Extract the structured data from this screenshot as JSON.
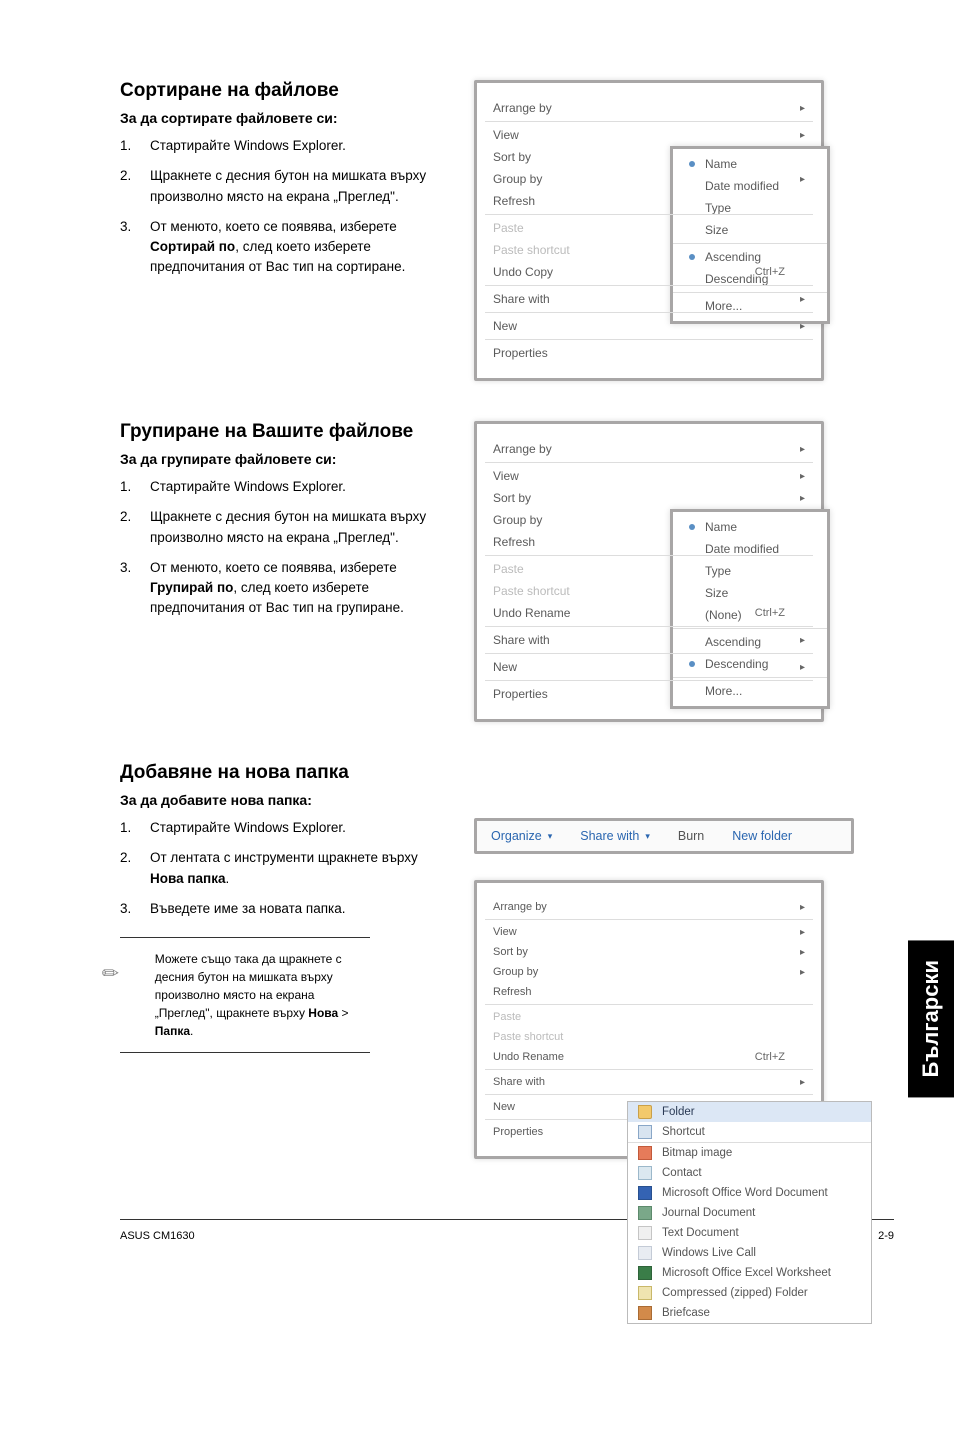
{
  "side_tab": "Български",
  "section1": {
    "heading": "Сортиране на файлове",
    "subheading": "За да сортирате файловете си:",
    "steps": [
      "Стартирайте Windows Explorer.",
      "Щракнете с десния бутон на мишката върху произволно място на екрана „Преглед\".",
      "От менюто, което се появява, изберете Сортирай по, след което изберете предпочитания от Вас тип на сортиране."
    ],
    "bold_in_step3": "Сортирай по"
  },
  "section2": {
    "heading": "Групиране на Вашите файлове",
    "subheading": "За да групирате файловете си:",
    "steps": [
      "Стартирайте Windows Explorer.",
      "Щракнете с десния бутон на мишката върху произволно място на екрана „Преглед\".",
      "От менюто, което се появява, изберете Групирай по, след което изберете предпочитания от Вас тип на групиране."
    ],
    "bold_in_step3": "Групирай по"
  },
  "section3": {
    "heading": "Добавяне на нова папка",
    "subheading": "За да добавите нова папка:",
    "steps": [
      "Стартирайте Windows Explorer.",
      "От лентата с инструменти щракнете върху Нова папка.",
      "Въведете име за новата папка."
    ],
    "bold_in_step2": "Нова папка",
    "tip": "Можете също така да щракнете с десния бутон на мишката върху произволно място на екрана „Преглед\", щракнете върху Нова > Папка.",
    "tip_bold1": "Нова",
    "tip_bold2": "Папка"
  },
  "menu1": {
    "items": [
      "Arrange by",
      "View",
      "Sort by",
      "Group by",
      "Refresh",
      "Paste",
      "Paste shortcut",
      "Undo Copy",
      "Share with",
      "New",
      "Properties"
    ],
    "shortcut": "Ctrl+Z",
    "submenu": [
      "Name",
      "Date modified",
      "Type",
      "Size",
      "Ascending",
      "Descending",
      "More..."
    ]
  },
  "menu2": {
    "items": [
      "Arrange by",
      "View",
      "Sort by",
      "Group by",
      "Refresh",
      "Paste",
      "Paste shortcut",
      "Undo Rename",
      "Share with",
      "New",
      "Properties"
    ],
    "shortcut": "Ctrl+Z",
    "submenu": [
      "Name",
      "Date modified",
      "Type",
      "Size",
      "(None)",
      "Ascending",
      "Descending",
      "More..."
    ]
  },
  "toolbar": {
    "organize": "Organize",
    "share": "Share with",
    "burn": "Burn",
    "newfolder": "New folder"
  },
  "menu3": {
    "items": [
      "Arrange by",
      "View",
      "Sort by",
      "Group by",
      "Refresh",
      "Paste",
      "Paste shortcut",
      "Undo Rename",
      "Share with",
      "New",
      "Properties"
    ],
    "shortcut": "Ctrl+Z",
    "new_items": [
      "Folder",
      "Shortcut",
      "Bitmap image",
      "Contact",
      "Microsoft Office Word Document",
      "Journal Document",
      "Text Document",
      "Windows Live Call",
      "Microsoft Office Excel Worksheet",
      "Compressed (zipped) Folder",
      "Briefcase"
    ]
  },
  "footer": {
    "left": "ASUS CM1630",
    "right": "2-9"
  }
}
